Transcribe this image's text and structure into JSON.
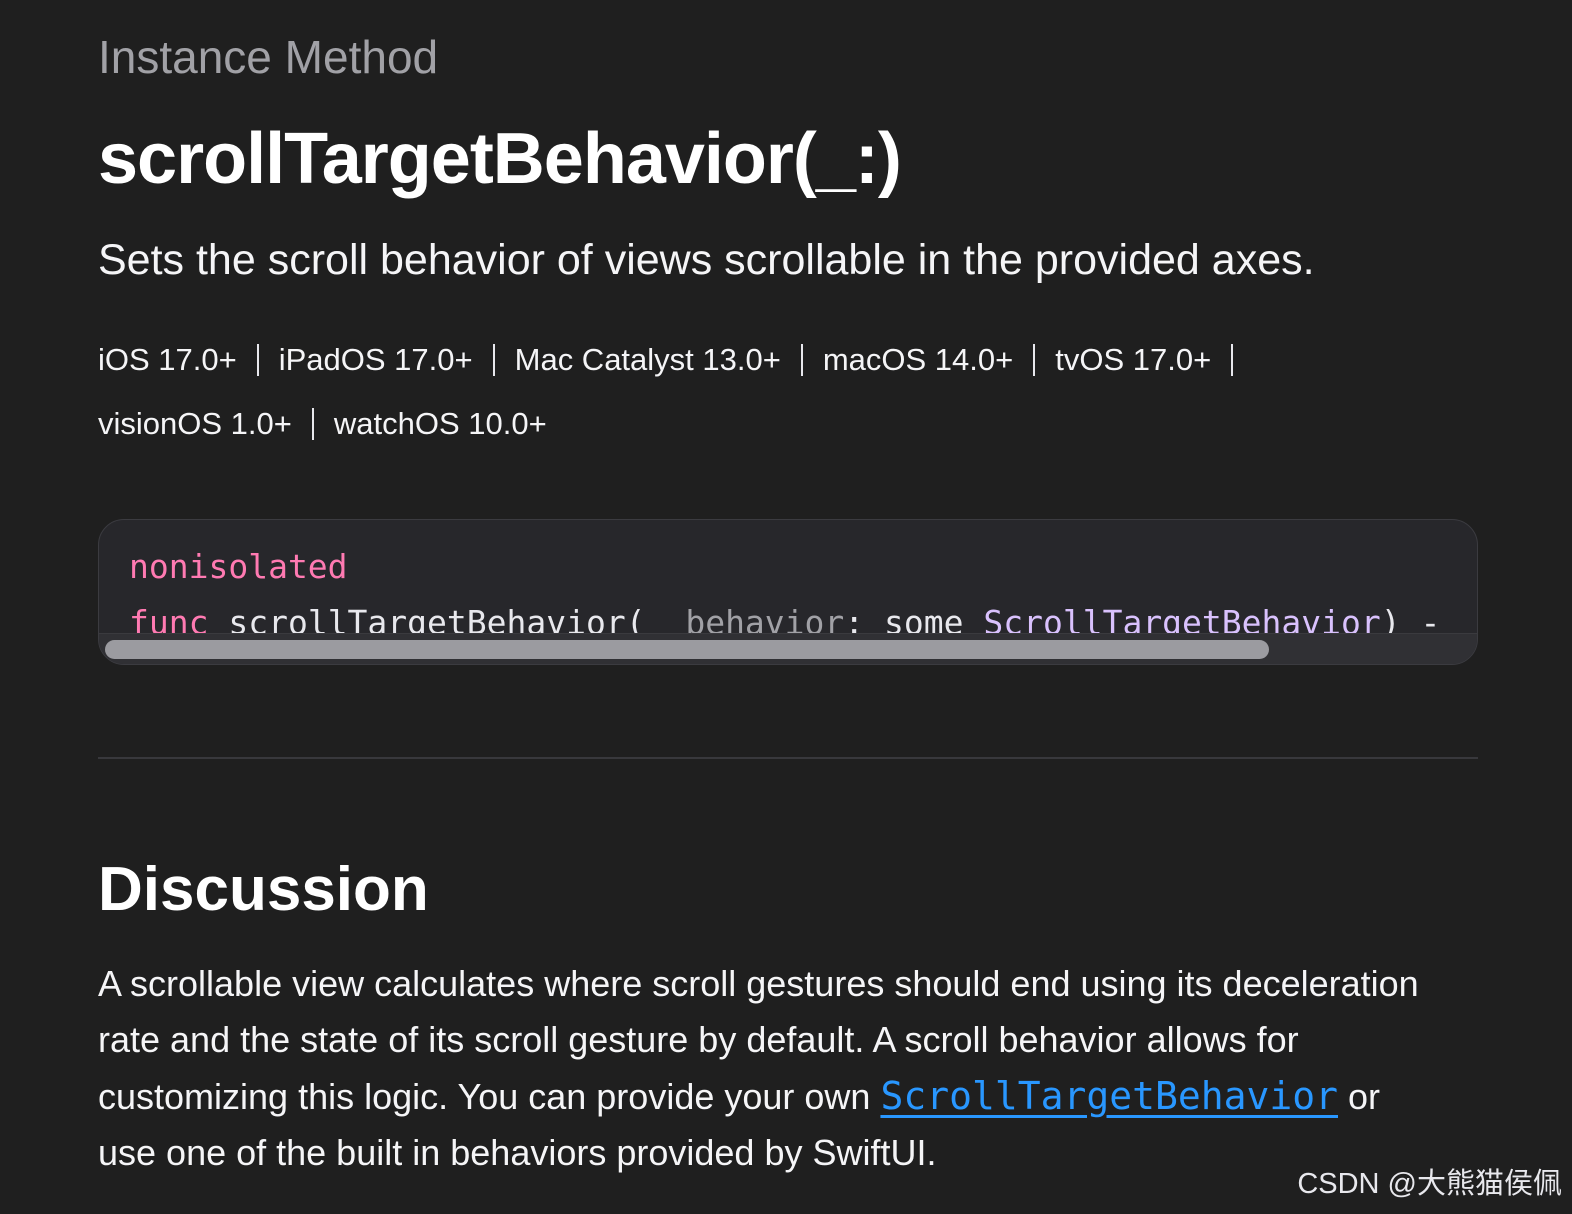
{
  "header": {
    "eyebrow": "Instance Method",
    "title": "scrollTargetBehavior(_:)",
    "abstract": "Sets the scroll behavior of views scrollable in the provided axes."
  },
  "platforms": [
    {
      "name": "iOS 17.0+"
    },
    {
      "name": "iPadOS 17.0+"
    },
    {
      "name": "Mac Catalyst 13.0+"
    },
    {
      "name": "macOS 14.0+"
    },
    {
      "name": "tvOS 17.0+"
    },
    {
      "name": "visionOS 1.0+"
    },
    {
      "name": "watchOS 10.0+"
    }
  ],
  "declaration": {
    "line1": "nonisolated",
    "func_keyword": "func",
    "func_name": " scrollTargetBehavior(",
    "underscore": "_ ",
    "param_name": "behavior",
    "colon": ": ",
    "some_keyword": "some ",
    "param_type": "ScrollTargetBehavior",
    "tail": ") -"
  },
  "discussion": {
    "heading": "Discussion",
    "line1": "A scrollable view calculates where scroll gestures should end using its deceleration",
    "line2": "rate and the state of its scroll gesture by default. A scroll behavior allows for",
    "line3_pre": "customizing this logic. You can provide your own ",
    "link_text": "ScrollTargetBehavior",
    "line3_post": " or",
    "line4": "use one of the built in behaviors provided by SwiftUI."
  },
  "watermark": "CSDN @大熊猫侯佩",
  "colors": {
    "background": "#1f1f1f",
    "keyword": "#ff7ab2",
    "type": "#d9c1fd",
    "link": "#2997ff",
    "eyebrow": "#a1a1a6"
  }
}
